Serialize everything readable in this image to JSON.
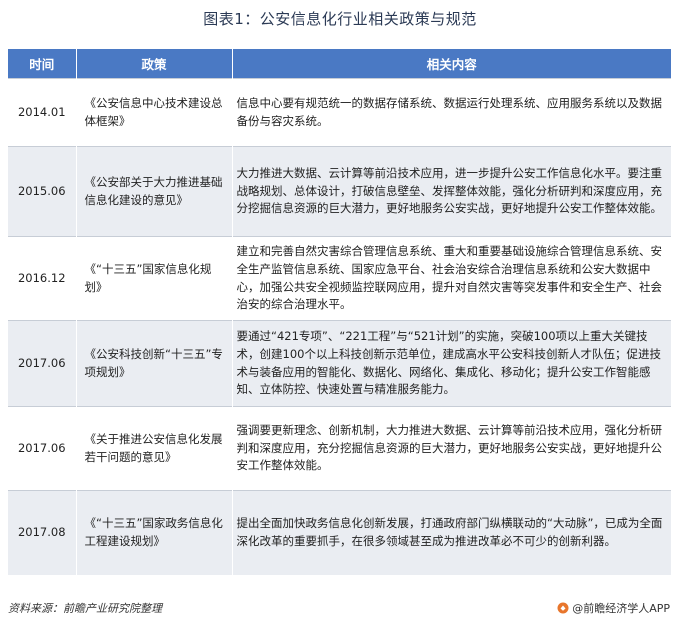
{
  "title": "图表1：公安信息化行业相关政策与规范",
  "table": {
    "headers": [
      "时间",
      "政策",
      "相关内容"
    ],
    "rows": [
      {
        "time": "2014.01",
        "policy": "《公安信息中心技术建设总体框架》",
        "content": "信息中心要有规范统一的数据存储系统、数据运行处理系统、应用服务系统以及数据备份与容灾系统。"
      },
      {
        "time": "2015.06",
        "policy": "《公安部关于大力推进基础信息化建设的意见》",
        "content": "大力推进大数据、云计算等前沿技术应用，进一步提升公安工作信息化水平。要注重战略规划、总体设计，打破信息壁垒、发挥整体效能，强化分析研判和深度应用，充分挖掘信息资源的巨大潜力，更好地服务公安实战，更好地提升公安工作整体效能。"
      },
      {
        "time": "2016.12",
        "policy": "《“十三五”国家信息化规划》",
        "content": "建立和完善自然灾害综合管理信息系统、重大和重要基础设施综合管理信息系统、安全生产监管信息系统、国家应急平台、社会治安综合治理信息系统和公安大数据中心，加强公共安全视频监控联网应用，提升对自然灾害等突发事件和安全生产、社会治安的综合治理水平。"
      },
      {
        "time": "2017.06",
        "policy": "《公安科技创新“十三五”专项规划》",
        "content": "要通过“421专项”、“221工程”与“521计划”的实施，突破100项以上重大关键技术，创建100个以上科技创新示范单位，建成高水平公安科技创新人才队伍；促进技术与装备应用的智能化、数据化、网络化、集成化、移动化；提升公安工作智能感知、立体防控、快速处置与精准服务能力。"
      },
      {
        "time": "2017.06",
        "policy": "《关于推进公安信息化发展若干问题的意见》",
        "content": "强调要更新理念、创新机制，大力推进大数据、云计算等前沿技术应用，强化分析研判和深度应用，充分挖掘信息资源的巨大潜力，更好地服务公安实战，更好地提升公安工作整体效能。"
      },
      {
        "time": "2017.08",
        "policy": "《“十三五”国家政务信息化工程建设规划》",
        "content": "提出全面加快政务信息化创新发展，打通政府部门纵横联动的“大动脉”，已成为全面深化改革的重要抓手，在很多领域甚至成为推进改革必不可少的创新利器。"
      }
    ]
  },
  "footer": {
    "source": "资料来源：前瞻产业研究院整理",
    "brand": "@前瞻经济学人APP"
  },
  "colors": {
    "header_bg": "#4a79c4",
    "row_alt_bg": "#eaedf2",
    "brand_orange": "#e8762c"
  }
}
